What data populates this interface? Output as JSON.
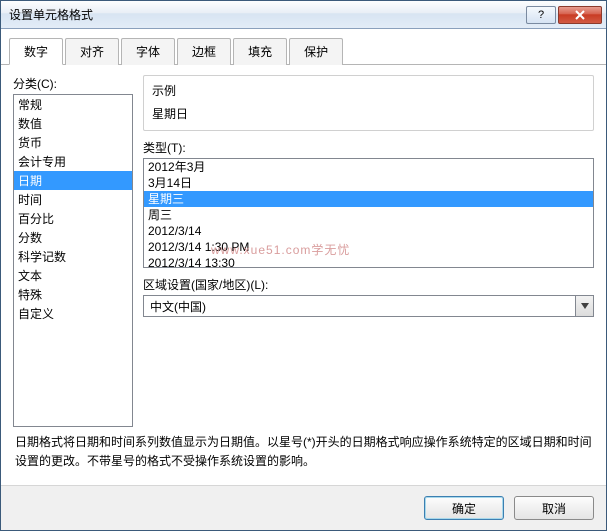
{
  "window": {
    "title": "设置单元格格式"
  },
  "tabs": {
    "items": [
      {
        "label": "数字"
      },
      {
        "label": "对齐"
      },
      {
        "label": "字体"
      },
      {
        "label": "边框"
      },
      {
        "label": "填充"
      },
      {
        "label": "保护"
      }
    ],
    "active_index": 0
  },
  "category": {
    "label": "分类(C):",
    "items": [
      "常规",
      "数值",
      "货币",
      "会计专用",
      "日期",
      "时间",
      "百分比",
      "分数",
      "科学记数",
      "文本",
      "特殊",
      "自定义"
    ],
    "selected_index": 4
  },
  "sample": {
    "label": "示例",
    "value": "星期日"
  },
  "type": {
    "label": "类型(T):",
    "items": [
      "2012年3月",
      "3月14日",
      "星期三",
      "周三",
      "2012/3/14",
      "2012/3/14 1:30 PM",
      "2012/3/14 13:30"
    ],
    "selected_index": 2
  },
  "locale": {
    "label": "区域设置(国家/地区)(L):",
    "value": "中文(中国)"
  },
  "description": "日期格式将日期和时间系列数值显示为日期值。以星号(*)开头的日期格式响应操作系统特定的区域日期和时间设置的更改。不带星号的格式不受操作系统设置的影响。",
  "footer": {
    "ok": "确定",
    "cancel": "取消"
  },
  "watermark": {
    "url": "www.xue51.com",
    "text": "学无忧"
  }
}
